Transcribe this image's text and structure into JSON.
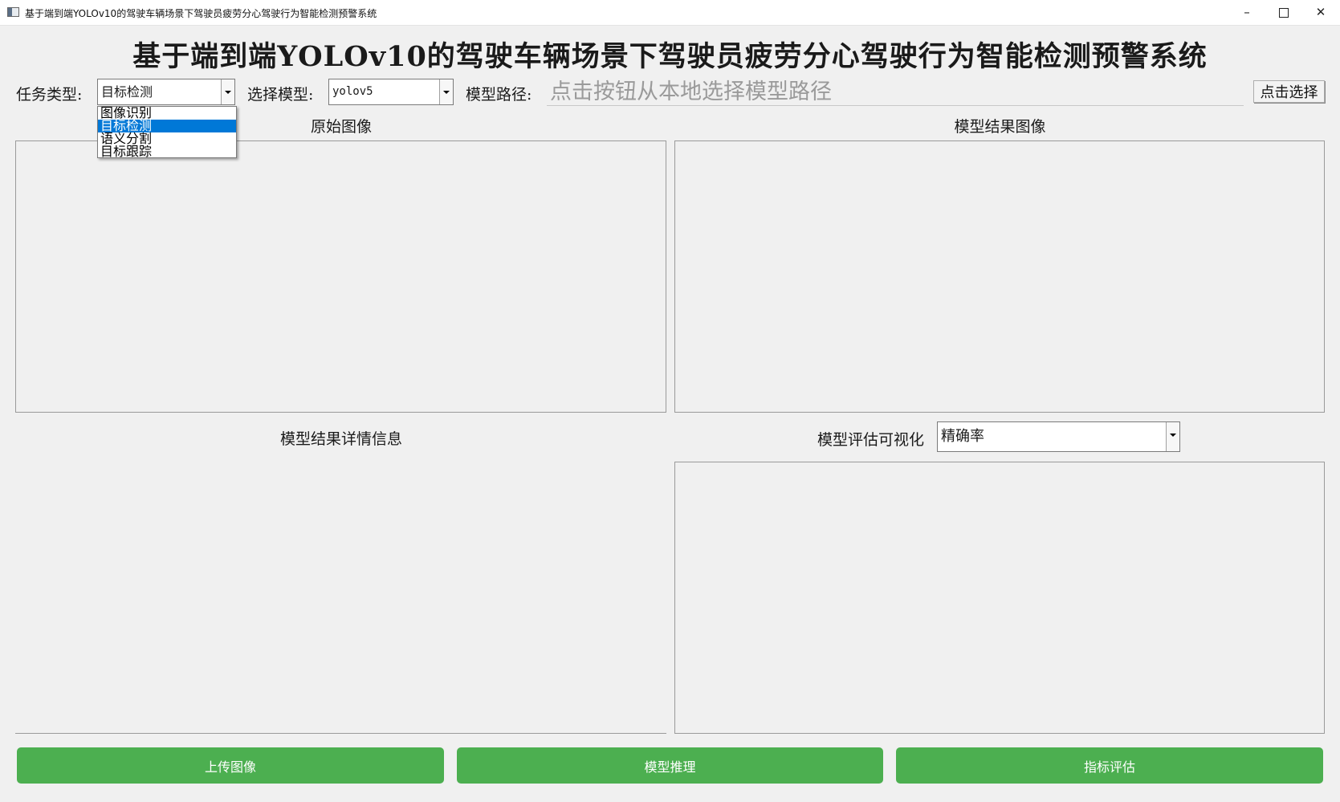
{
  "window": {
    "title": "基于端到端YOLOv10的驾驶车辆场景下驾驶员疲劳分心驾驶行为智能检测预警系统",
    "minimize": "–",
    "close": "✕"
  },
  "header": {
    "title": "基于端到端YOLOv10的驾驶车辆场景下驾驶员疲劳分心驾驶行为智能检测预警系统"
  },
  "controls": {
    "task_label": "任务类型:",
    "task_value": "目标检测",
    "task_options": [
      "图像识别",
      "目标检测",
      "语义分割",
      "目标跟踪"
    ],
    "task_selected_index": 1,
    "model_label": "选择模型:",
    "model_value": "yolov5",
    "path_label": "模型路径:",
    "path_placeholder": "点击按钮从本地选择模型路径",
    "path_value": "",
    "pick_button": "点击选择"
  },
  "panels": {
    "original_title": "原始图像",
    "result_title": "模型结果图像",
    "details_title": "模型结果详情信息",
    "eval_label": "模型评估可视化",
    "eval_value": "精确率"
  },
  "actions": {
    "upload": "上传图像",
    "infer": "模型推理",
    "evaluate": "指标评估"
  },
  "colors": {
    "action_button": "#4caf50",
    "selection": "#0078d7"
  }
}
